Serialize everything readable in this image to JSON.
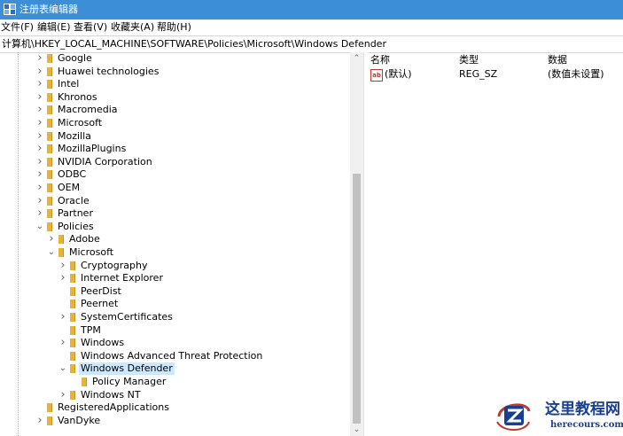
{
  "window": {
    "title": "注册表编辑器"
  },
  "menu": [
    "文件(F)",
    "编辑(E)",
    "查看(V)",
    "收藏夹(A)",
    "帮助(H)"
  ],
  "address": "计算机\\HKEY_LOCAL_MACHINE\\SOFTWARE\\Policies\\Microsoft\\Windows Defender",
  "tree": [
    {
      "label": "Google",
      "level": 0,
      "arrow": "collapsed"
    },
    {
      "label": "Huawei technologies",
      "level": 0,
      "arrow": "collapsed"
    },
    {
      "label": "Intel",
      "level": 0,
      "arrow": "collapsed"
    },
    {
      "label": "Khronos",
      "level": 0,
      "arrow": "collapsed"
    },
    {
      "label": "Macromedia",
      "level": 0,
      "arrow": "collapsed"
    },
    {
      "label": "Microsoft",
      "level": 0,
      "arrow": "collapsed"
    },
    {
      "label": "Mozilla",
      "level": 0,
      "arrow": "collapsed"
    },
    {
      "label": "MozillaPlugins",
      "level": 0,
      "arrow": "collapsed"
    },
    {
      "label": "NVIDIA Corporation",
      "level": 0,
      "arrow": "collapsed"
    },
    {
      "label": "ODBC",
      "level": 0,
      "arrow": "collapsed"
    },
    {
      "label": "OEM",
      "level": 0,
      "arrow": "collapsed"
    },
    {
      "label": "Oracle",
      "level": 0,
      "arrow": "collapsed"
    },
    {
      "label": "Partner",
      "level": 0,
      "arrow": "collapsed"
    },
    {
      "label": "Policies",
      "level": 0,
      "arrow": "expanded"
    },
    {
      "label": "Adobe",
      "level": 1,
      "arrow": "collapsed"
    },
    {
      "label": "Microsoft",
      "level": 1,
      "arrow": "expanded"
    },
    {
      "label": "Cryptography",
      "level": 2,
      "arrow": "collapsed"
    },
    {
      "label": "Internet Explorer",
      "level": 2,
      "arrow": "collapsed"
    },
    {
      "label": "PeerDist",
      "level": 2,
      "arrow": "none"
    },
    {
      "label": "Peernet",
      "level": 2,
      "arrow": "none"
    },
    {
      "label": "SystemCertificates",
      "level": 2,
      "arrow": "collapsed"
    },
    {
      "label": "TPM",
      "level": 2,
      "arrow": "none"
    },
    {
      "label": "Windows",
      "level": 2,
      "arrow": "collapsed"
    },
    {
      "label": "Windows Advanced Threat Protection",
      "level": 2,
      "arrow": "none"
    },
    {
      "label": "Windows Defender",
      "level": 2,
      "arrow": "expanded",
      "selected": true
    },
    {
      "label": "Policy Manager",
      "level": 3,
      "arrow": "none"
    },
    {
      "label": "Windows NT",
      "level": 2,
      "arrow": "collapsed"
    },
    {
      "label": "RegisteredApplications",
      "level": 0,
      "arrow": "none"
    },
    {
      "label": "VanDyke",
      "level": 0,
      "arrow": "collapsed"
    }
  ],
  "values_pane": {
    "headers": {
      "name": "名称",
      "type": "类型",
      "data": "数据"
    },
    "rows": [
      {
        "icon": "string-value-icon",
        "icon_text": "ab",
        "name": "(默认)",
        "type": "REG_SZ",
        "data": "(数值未设置)"
      }
    ]
  },
  "watermark": {
    "title": "这里教程网",
    "url": "herecours.com"
  },
  "colors": {
    "titlebar": "#3c8fd6",
    "selection": "#cce8ff",
    "folder": "#e8b339",
    "watermark": "#1a3f91"
  }
}
